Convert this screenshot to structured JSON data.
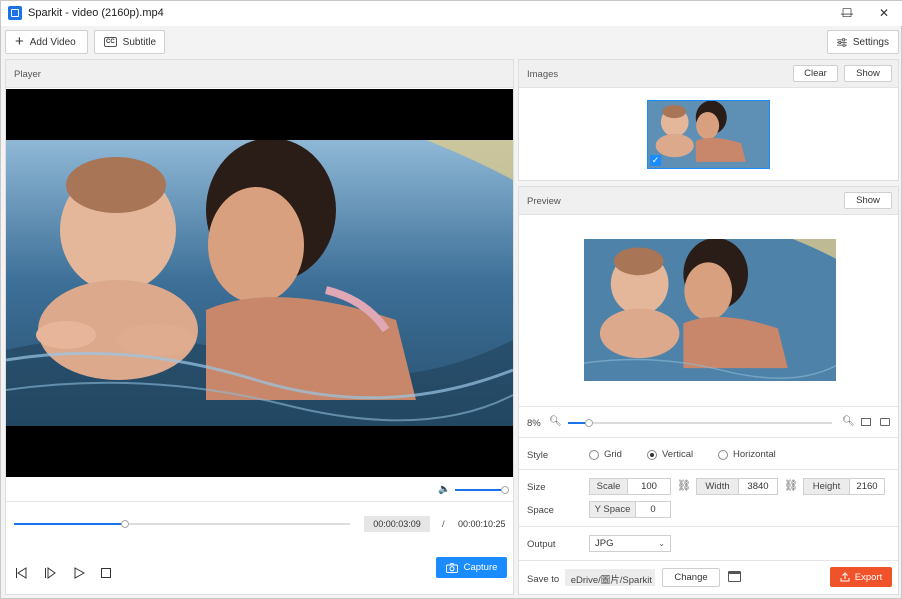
{
  "window": {
    "title": "Sparkit - video (2160p).mp4",
    "minimize": "—",
    "maximize": "☐",
    "close": "✕"
  },
  "toolbar": {
    "add_video": "Add Video",
    "subtitle": "Subtitle",
    "settings": "Settings",
    "cc": "CC"
  },
  "player": {
    "title": "Player",
    "progress": 0.33,
    "volume": 1.0,
    "current_time": "00:00:03:09",
    "separator": "/",
    "total_time": "00:00:10:25",
    "capture_label": "Capture"
  },
  "images": {
    "title": "Images",
    "clear_label": "Clear",
    "show_label": "Show"
  },
  "preview": {
    "title": "Preview",
    "show_label": "Show",
    "zoom_text": "8%",
    "zoom_level": 0.08
  },
  "style": {
    "label": "Style",
    "options": [
      {
        "label": "Grid",
        "selected": false
      },
      {
        "label": "Vertical",
        "selected": true
      },
      {
        "label": "Horizontal",
        "selected": false
      }
    ]
  },
  "size": {
    "label": "Size",
    "scale_label": "Scale",
    "scale_value": "100",
    "width_label": "Width",
    "width_value": "3840",
    "height_label": "Height",
    "height_value": "2160"
  },
  "space": {
    "label": "Space",
    "yspace_label": "Y Space",
    "yspace_value": "0"
  },
  "output": {
    "label": "Output",
    "format": "JPG"
  },
  "save": {
    "label": "Save to",
    "path": "eDrive/圖片/Sparkit",
    "change_label": "Change",
    "export_label": "Export"
  },
  "colors": {
    "accent": "#1a8cff",
    "export": "#f0522a",
    "track": "#1a73e8"
  }
}
